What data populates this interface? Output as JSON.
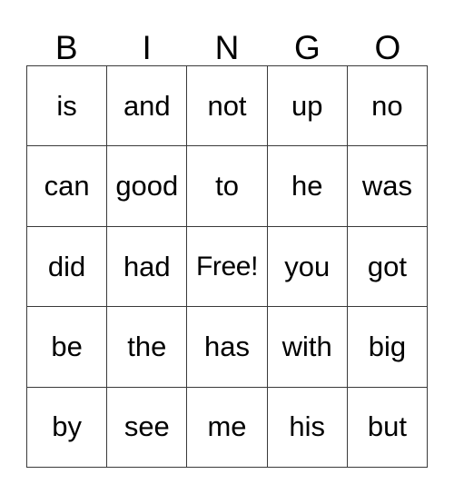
{
  "card": {
    "title": "BINGO",
    "headers": [
      "B",
      "I",
      "N",
      "G",
      "O"
    ],
    "free_space_label": "Free!",
    "colors": {
      "background": "#ffffff",
      "text": "#000000",
      "grid_line": "#3a3a3a"
    },
    "grid": [
      [
        "is",
        "and",
        "not",
        "up",
        "no"
      ],
      [
        "can",
        "good",
        "to",
        "he",
        "was"
      ],
      [
        "did",
        "had",
        "Free!",
        "you",
        "got"
      ],
      [
        "be",
        "the",
        "has",
        "with",
        "big"
      ],
      [
        "by",
        "see",
        "me",
        "his",
        "but"
      ]
    ]
  }
}
